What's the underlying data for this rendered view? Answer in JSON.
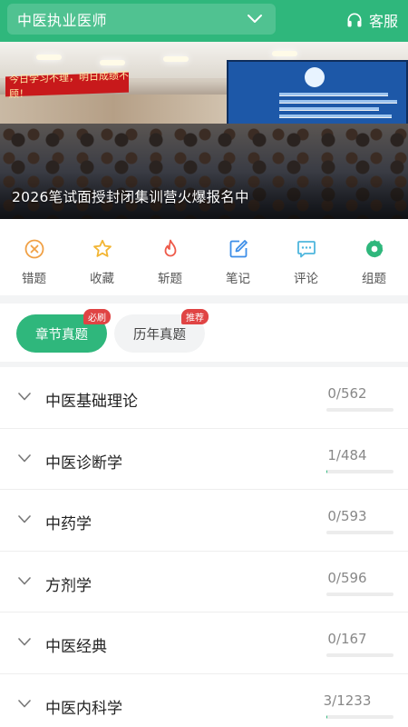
{
  "header": {
    "exam_name": "中医执业医师",
    "service_label": "客服"
  },
  "banner": {
    "caption": "2026笔试面授封闭集训营火爆报名中",
    "sign_text": "今日学习不理，明日成绩不顾！"
  },
  "quick_actions": [
    {
      "label": "错题",
      "icon": "wrong-question-icon",
      "color": "#f0a045"
    },
    {
      "label": "收藏",
      "icon": "star-icon",
      "color": "#f2b533"
    },
    {
      "label": "斩题",
      "icon": "flame-icon",
      "color": "#ee5a4a"
    },
    {
      "label": "笔记",
      "icon": "note-edit-icon",
      "color": "#3d8ee8"
    },
    {
      "label": "评论",
      "icon": "comment-icon",
      "color": "#4fb6dd"
    },
    {
      "label": "组题",
      "icon": "gear-icon",
      "color": "#2fb77c"
    }
  ],
  "tabs": [
    {
      "label": "章节真题",
      "badge": "必刷",
      "active": true
    },
    {
      "label": "历年真题",
      "badge": "推荐",
      "active": false
    }
  ],
  "chapters": [
    {
      "name": "中医基础理论",
      "count": "0/562",
      "done": 0,
      "total": 562
    },
    {
      "name": "中医诊断学",
      "count": "1/484",
      "done": 1,
      "total": 484
    },
    {
      "name": "中药学",
      "count": "0/593",
      "done": 0,
      "total": 593
    },
    {
      "name": "方剂学",
      "count": "0/596",
      "done": 0,
      "total": 596
    },
    {
      "name": "中医经典",
      "count": "0/167",
      "done": 0,
      "total": 167
    },
    {
      "name": "中医内科学",
      "count": "3/1233",
      "done": 3,
      "total": 1233
    }
  ],
  "colors": {
    "brand_green": "#2fb77c",
    "badge_red": "#e04444"
  }
}
